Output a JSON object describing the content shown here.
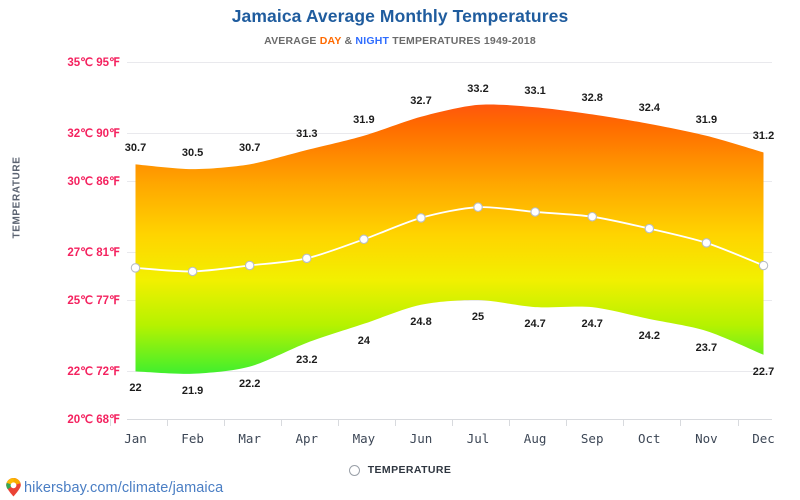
{
  "header": {
    "title": "Jamaica Average Monthly Temperatures",
    "subtitle_prefix": "AVERAGE ",
    "subtitle_day": "DAY",
    "subtitle_amp": " & ",
    "subtitle_night": "NIGHT",
    "subtitle_suffix": " TEMPERATURES 1949-2018"
  },
  "legend": {
    "label": "TEMPERATURE",
    "marker_icon": "hollow-circle-icon"
  },
  "footer": {
    "url": "hikersbay.com/climate/jamaica",
    "pin_icon": "map-pin-icon"
  },
  "colors": {
    "title": "#1f5c9e",
    "day_accent": "#ff6a00",
    "night_accent": "#2f6dff",
    "ytick": "#f4225f",
    "xtick": "#3d4756",
    "gridline": "#e9e9ed",
    "line": "#ffffff",
    "url": "#4a7ec4"
  },
  "chart_data": {
    "type": "area",
    "title": "Jamaica Average Monthly Temperatures",
    "subtitle": "AVERAGE DAY & NIGHT TEMPERATURES 1949-2018",
    "xlabel": "",
    "ylabel": "TEMPERATURE",
    "grid": true,
    "legend_position": "bottom",
    "categories": [
      "Jan",
      "Feb",
      "Mar",
      "Apr",
      "May",
      "Jun",
      "Jul",
      "Aug",
      "Sep",
      "Oct",
      "Nov",
      "Dec"
    ],
    "ylim": [
      20,
      35
    ],
    "yticks": [
      {
        "value": 35,
        "label": "35℃ 95℉"
      },
      {
        "value": 32,
        "label": "32℃ 90℉"
      },
      {
        "value": 30,
        "label": "30℃ 86℉"
      },
      {
        "value": 27,
        "label": "27℃ 81℉"
      },
      {
        "value": 25,
        "label": "25℃ 77℉"
      },
      {
        "value": 22,
        "label": "22℃ 72℉"
      },
      {
        "value": 20,
        "label": "20℃ 68℉"
      }
    ],
    "series": [
      {
        "name": "DAY",
        "type": "upper-band",
        "values": [
          30.7,
          30.5,
          30.7,
          31.3,
          31.9,
          32.7,
          33.2,
          33.1,
          32.8,
          32.4,
          31.9,
          31.2
        ],
        "labels": [
          "30.7",
          "30.5",
          "30.7",
          "31.3",
          "31.9",
          "32.7",
          "33.2",
          "33.1",
          "32.8",
          "32.4",
          "31.9",
          "31.2"
        ]
      },
      {
        "name": "NIGHT",
        "type": "lower-band",
        "values": [
          22,
          21.9,
          22.2,
          23.2,
          24,
          24.8,
          25,
          24.7,
          24.7,
          24.2,
          23.7,
          22.7
        ],
        "labels": [
          "22",
          "21.9",
          "22.2",
          "23.2",
          "24",
          "24.8",
          "25",
          "24.7",
          "24.7",
          "24.2",
          "23.7",
          "22.7"
        ]
      },
      {
        "name": "TEMPERATURE",
        "type": "line",
        "values": [
          26.35,
          26.2,
          26.45,
          26.75,
          27.55,
          28.45,
          28.9,
          28.7,
          28.5,
          28,
          27.4,
          26.45
        ],
        "labels": [
          "",
          "",
          "",
          "",
          "",
          "",
          "",
          "",
          "",
          "",
          "",
          ""
        ]
      }
    ]
  }
}
